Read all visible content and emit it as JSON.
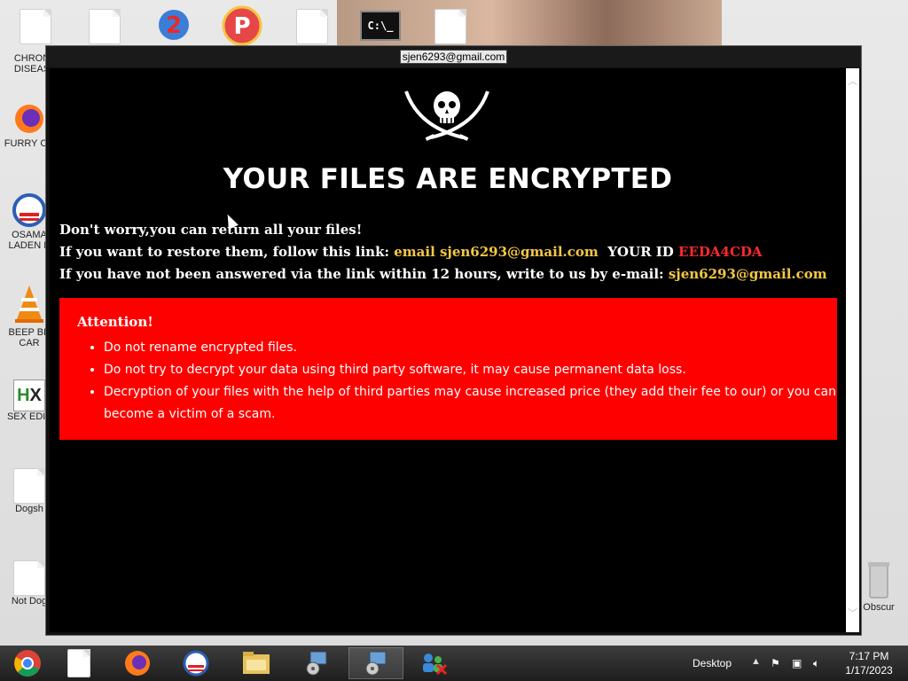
{
  "window": {
    "title": "sjen6293@gmail.com"
  },
  "note": {
    "heading": "YOUR FILES ARE ENCRYPTED",
    "line1": "Don't worry,you can return all your files!",
    "line2_prefix": "If you want to restore them, follow this link:",
    "line2_link": "email sjen6293@gmail.com",
    "line2_id_label": "YOUR ID",
    "line2_id_value": "EEDA4CDA",
    "line3_prefix": "If you have not been answered via the link within 12 hours, write to us by e-mail:",
    "line3_email": "sjen6293@gmail.com",
    "attention": {
      "title": "Attention!",
      "items": [
        "Do not rename encrypted files.",
        "Do not try to decrypt your data using third party software, it may cause permanent data loss.",
        "Decryption of your files with the help of third parties may cause increased price (they add their fee to our) or you can become a victim of a scam."
      ]
    }
  },
  "desktop": {
    "icons": [
      {
        "label": "CHRON\nDISEAS",
        "icon": "document-icon"
      },
      {
        "label": "FURRY CU",
        "icon": "firefox-icon"
      },
      {
        "label": "OSAMA\nLADEN B",
        "icon": "obama-logo-icon"
      },
      {
        "label": "BEEP BE\nCAR",
        "icon": "vlc-cone-icon"
      },
      {
        "label": "SEX EDIT",
        "icon": "hex-editor-icon"
      },
      {
        "label": "Dogsh",
        "icon": "document-icon"
      },
      {
        "label": "Not Dog",
        "icon": "document-icon"
      },
      {
        "label": "Obscur",
        "icon": "recycle-bin-icon"
      }
    ]
  },
  "taskbar": {
    "tray_label": "Desktop",
    "time": "7:17 PM",
    "date": "1/17/2023"
  },
  "colors": {
    "note_bg": "#000000",
    "accent_yellow": "#f5c842",
    "accent_red": "#ff2a2a",
    "attention_bg": "#ff0000"
  }
}
